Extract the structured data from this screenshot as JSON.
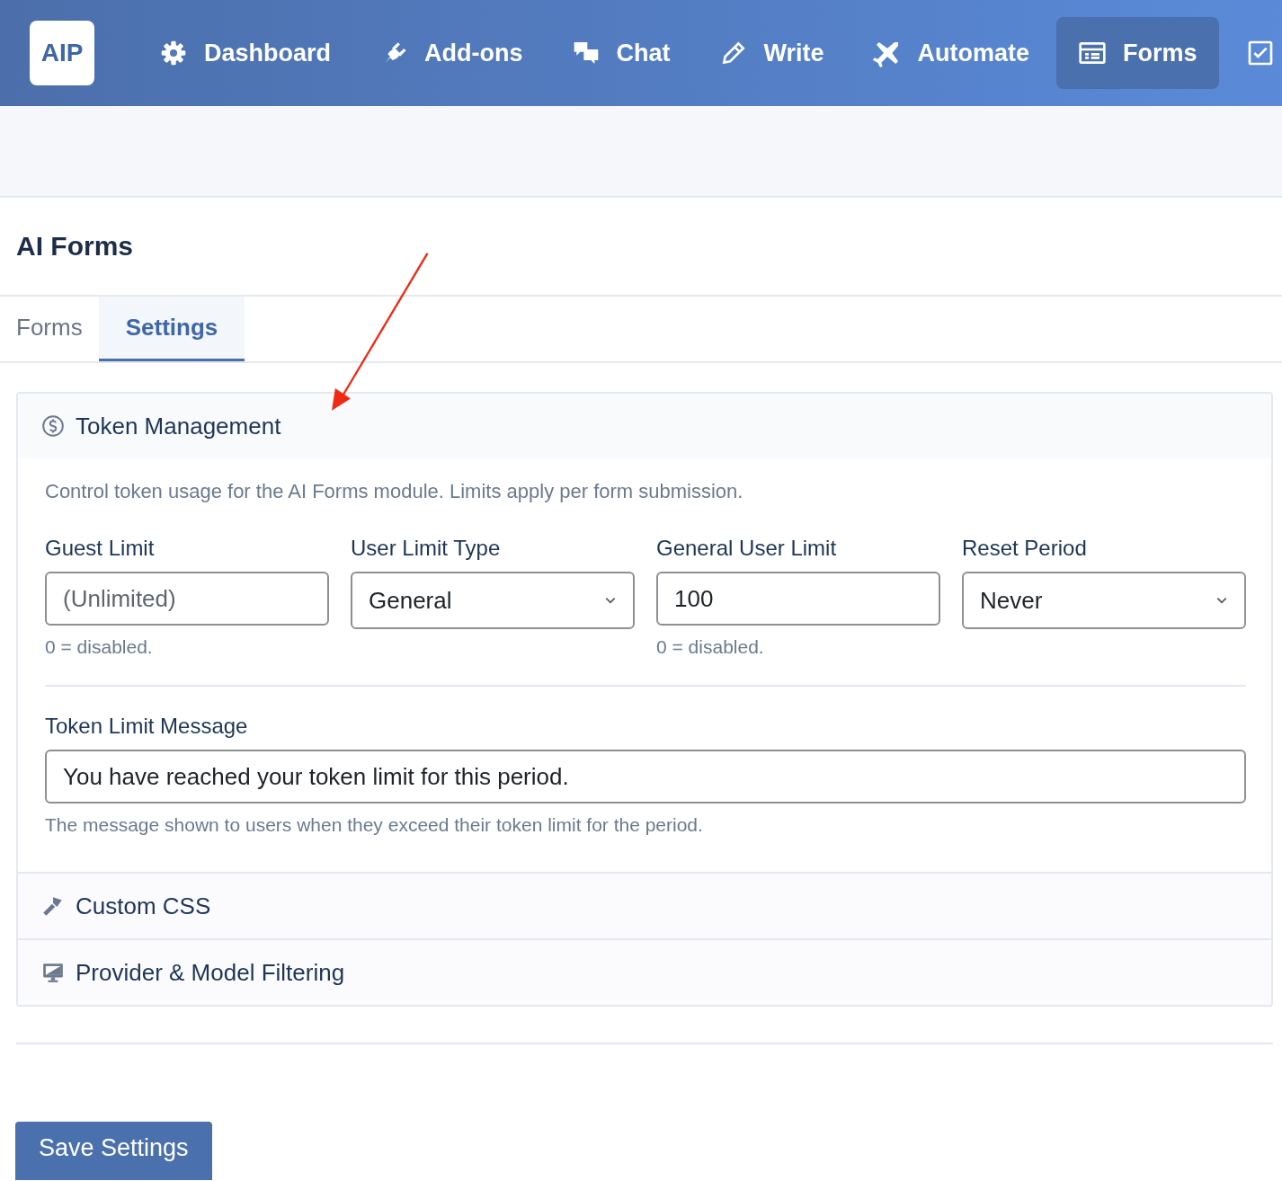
{
  "nav": {
    "logo": "AIP",
    "items": [
      {
        "label": "Dashboard",
        "selected": false
      },
      {
        "label": "Add-ons",
        "selected": false
      },
      {
        "label": "Chat",
        "selected": false
      },
      {
        "label": "Write",
        "selected": false
      },
      {
        "label": "Automate",
        "selected": false
      },
      {
        "label": "Forms",
        "selected": true
      },
      {
        "selected": false
      }
    ]
  },
  "page_title": "AI Forms",
  "tabs": [
    {
      "label": "Forms",
      "selected": false
    },
    {
      "label": "Settings",
      "selected": true
    }
  ],
  "sections": [
    {
      "title": "Token Management",
      "expanded": true,
      "description": "Control token usage for the AI Forms module. Limits apply per form submission.",
      "fields": [
        {
          "kind": "input",
          "label": "Guest Limit",
          "placeholder": "(Unlimited)",
          "hint": "0 = disabled."
        },
        {
          "kind": "select",
          "label": "User Limit Type",
          "value": "General"
        },
        {
          "kind": "input",
          "label": "General User Limit",
          "value": "100",
          "hint": "0 = disabled."
        },
        {
          "kind": "select",
          "label": "Reset Period",
          "value": "Never"
        }
      ],
      "message": {
        "label": "Token Limit Message",
        "value": "You have reached your token limit for this period.",
        "hint": "The message shown to users when they exceed their token limit for the period."
      }
    },
    {
      "title": "Custom CSS",
      "expanded": false
    },
    {
      "title": "Provider & Model Filtering",
      "expanded": false
    }
  ],
  "save_button": "Save Settings"
}
